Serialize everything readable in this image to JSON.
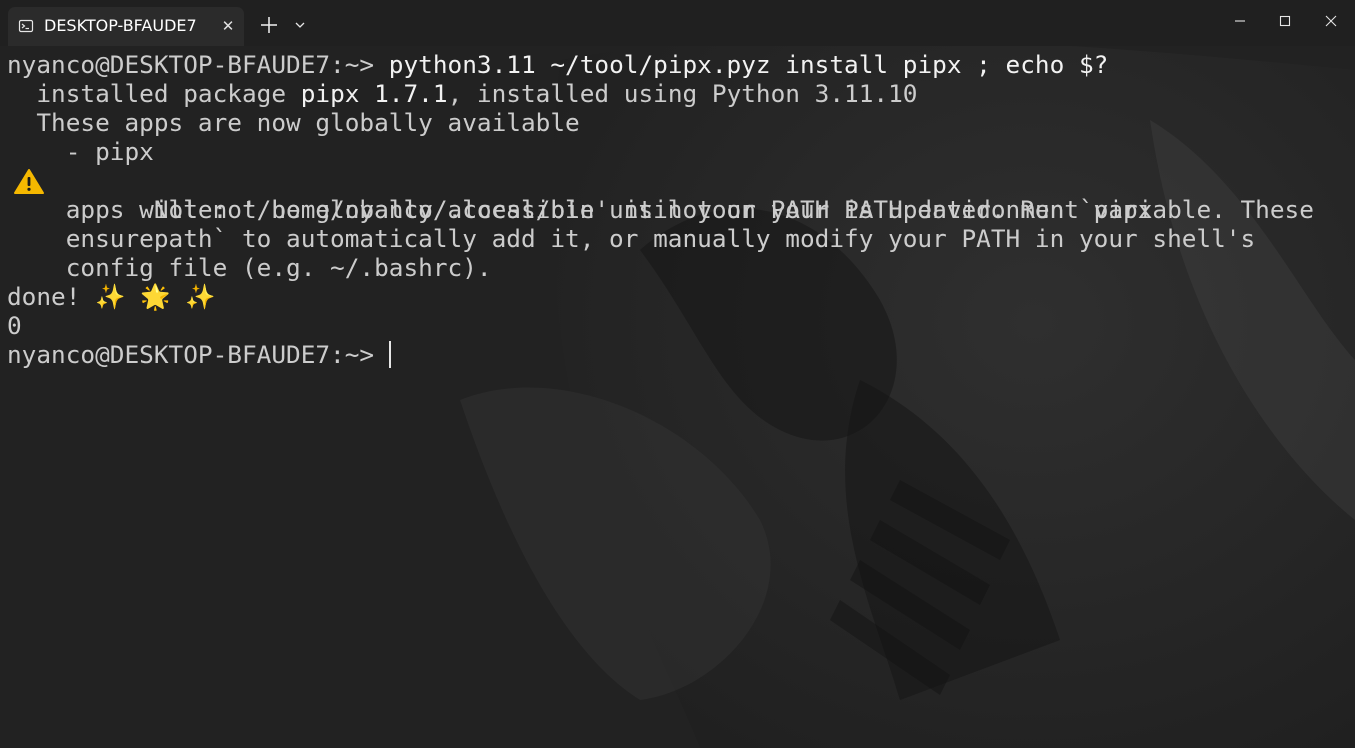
{
  "window": {
    "tab_title": "DESKTOP-BFAUDE7",
    "tab_close_glyph": "✕",
    "tab_icon": "terminal-icon",
    "new_tab_icon": "plus-icon",
    "dropdown_icon": "chevron-down-icon",
    "controls": [
      "minimize-icon",
      "maximize-icon",
      "close-icon"
    ]
  },
  "terminal": {
    "prompt": "nyanco@DESKTOP-BFAUDE7:~>",
    "command": " python3.11 ~/tool/pipx.pyz install pipx ; echo $?",
    "out1_prefix": "  installed package ",
    "out1_pkg": "pipx 1.7.1",
    "out1_suffix": ", installed using Python 3.11.10",
    "out2": "  These apps are now globally available",
    "out3": "    - pipx",
    "warn_icon": "warning-icon",
    "note1": "    Note: '/home/nyanco/.local/bin' is not on your PATH environment variable. These",
    "note2": "    apps will not be globally accessible until your PATH is updated. Run `pipx",
    "note3": "    ensurepath` to automatically add it, or manually modify your PATH in your shell's",
    "note4": "    config file (e.g. ~/.bashrc).",
    "done": "done! ✨ 🌟 ✨",
    "exit_code": "0",
    "prompt2": "nyanco@DESKTOP-BFAUDE7:~>"
  },
  "colors": {
    "background": "#222222",
    "titlebar": "#202020",
    "tab": "#2b2b2b",
    "text": "#cccccc",
    "bright_text": "#f2f2f2",
    "warning": "#f5b800"
  }
}
